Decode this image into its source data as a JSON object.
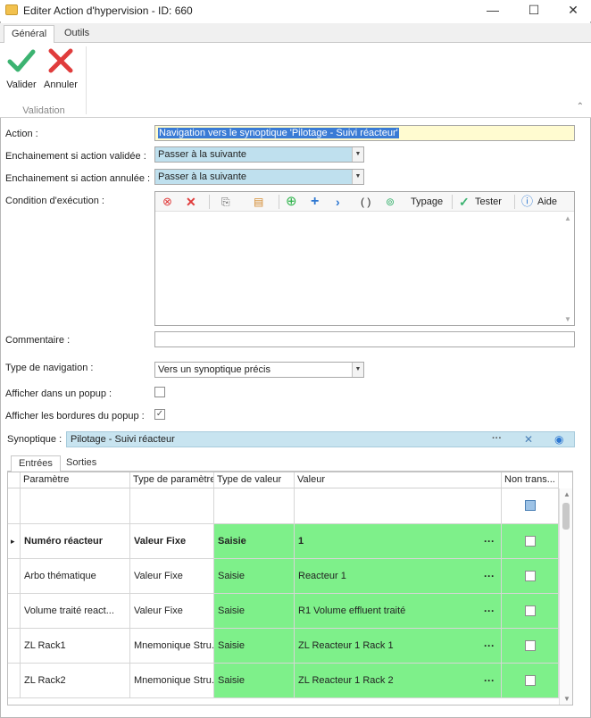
{
  "window": {
    "title": "Editer Action d'hypervision - ID: 660",
    "minimize": "—",
    "maximize": "☐",
    "close": "✕"
  },
  "ribbon": {
    "tabs": [
      "Général",
      "Outils"
    ],
    "valider_label": "Valider",
    "annuler_label": "Annuler",
    "group_label": "Validation"
  },
  "form": {
    "action_label": "Action :",
    "action_value": "Navigation vers le synoptique 'Pilotage - Suivi réacteur'",
    "enchainement_valide_label": "Enchainement si action validée :",
    "enchainement_valide_value": "Passer à la suivante",
    "enchainement_annule_label": "Enchainement si action annulée :",
    "enchainement_annule_value": "Passer à la suivante",
    "condition_label": "Condition d'exécution :",
    "commentaire_label": "Commentaire :",
    "commentaire_value": "",
    "type_nav_label": "Type de navigation :",
    "type_nav_value": "Vers un synoptique précis",
    "popup_label": "Afficher dans un popup :",
    "popup_checked": false,
    "bordures_label": "Afficher les bordures du popup :",
    "bordures_checked": true
  },
  "condition_toolbar": {
    "typage_label": "Typage",
    "tester_label": "Tester",
    "aide_label": "Aide",
    "parentheses": "( )"
  },
  "synoptique": {
    "label": "Synoptique :",
    "value": "Pilotage - Suivi réacteur",
    "more": "···",
    "clear": "✕"
  },
  "subtabs": [
    "Entrées",
    "Sorties"
  ],
  "grid": {
    "columns": [
      "Paramètre",
      "Type de paramètre",
      "Type de valeur",
      "Valeur",
      "Non trans..."
    ],
    "rows": [
      {
        "param": "Numéro réacteur",
        "type_param": "Valeur Fixe",
        "type_val": "Saisie",
        "valeur": "1",
        "bold": true,
        "current": true
      },
      {
        "param": "Arbo thématique",
        "type_param": "Valeur Fixe",
        "type_val": "Saisie",
        "valeur": "Reacteur 1",
        "bold": false
      },
      {
        "param": "Volume traité react...",
        "type_param": "Valeur Fixe",
        "type_val": "Saisie",
        "valeur": "R1 Volume effluent traité",
        "bold": false
      },
      {
        "param": "ZL Rack1",
        "type_param": "Mnemonique Stru...",
        "type_val": "Saisie",
        "valeur": "ZL Reacteur 1 Rack 1",
        "bold": false
      },
      {
        "param": "ZL Rack2",
        "type_param": "Mnemonique Stru...",
        "type_val": "Saisie",
        "valeur": "ZL Reacteur 1 Rack 2",
        "bold": false
      }
    ],
    "cell_more": "···",
    "row_indicator": "▸"
  },
  "colors": {
    "green": "#7ef08a",
    "selection_blue": "#bfe0ee",
    "highlight_yellow": "#fffbd0",
    "valider_green": "#3cb371",
    "annuler_red": "#e03c3c"
  }
}
